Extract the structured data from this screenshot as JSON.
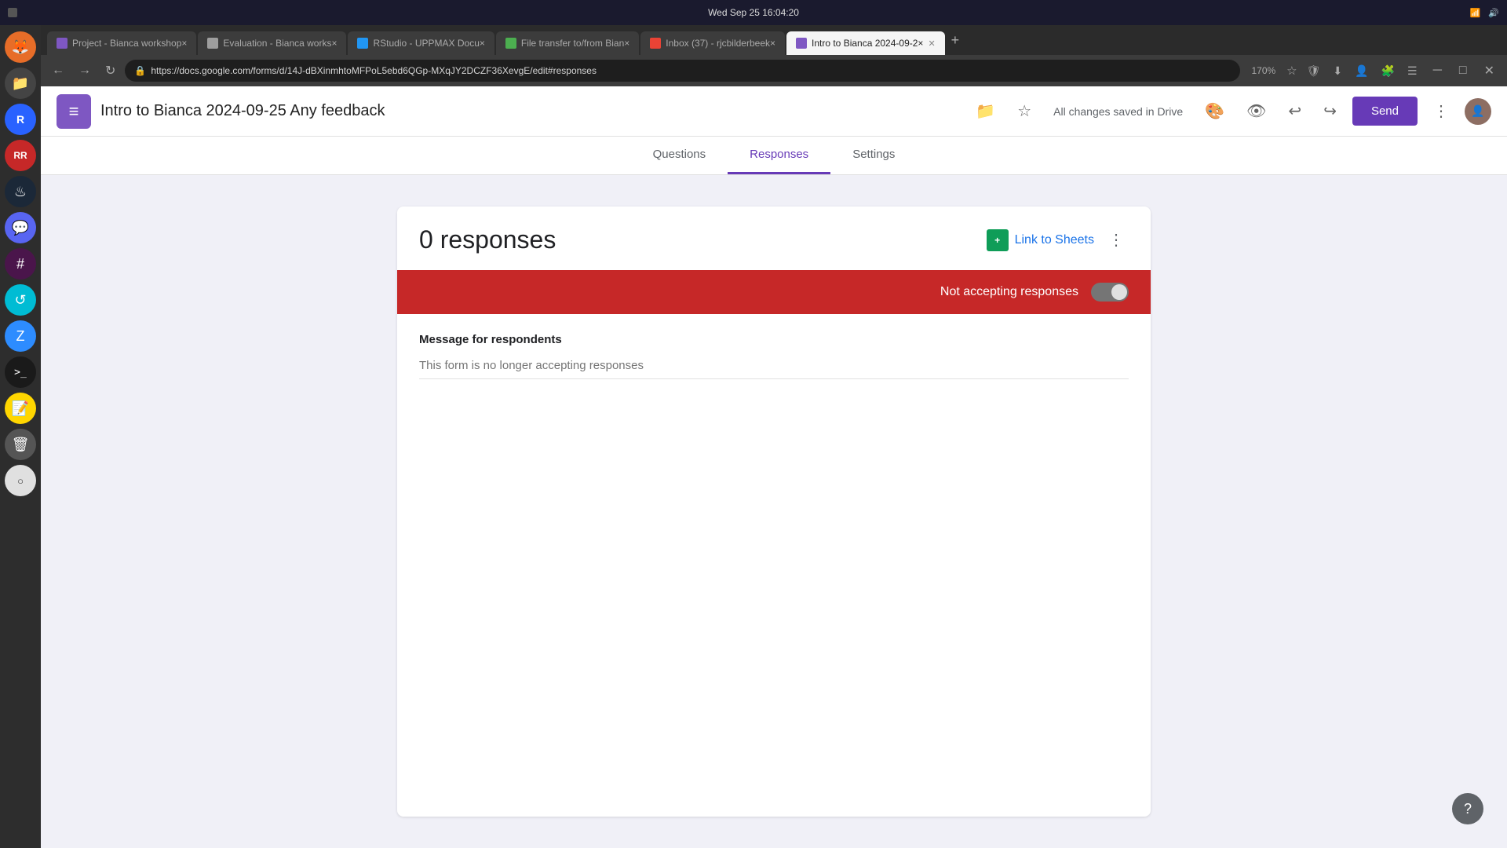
{
  "taskbar": {
    "datetime": "Wed Sep 25  16:04:20",
    "start_label": "⊞"
  },
  "browser": {
    "tabs": [
      {
        "id": "tab-project",
        "favicon_class": "purple",
        "label": "Project - Bianca workshop×",
        "active": false
      },
      {
        "id": "tab-evaluation",
        "favicon_class": "eval",
        "label": "Evaluation - Bianca works×",
        "active": false
      },
      {
        "id": "tab-rstudio",
        "favicon_class": "rstudio",
        "label": "RStudio - UPPMAX Docu×",
        "active": false
      },
      {
        "id": "tab-file-transfer",
        "favicon_class": "file-transfer",
        "label": "File transfer to/from Bian×",
        "active": false
      },
      {
        "id": "tab-gmail",
        "favicon_class": "gmail",
        "label": "Inbox (37) - rjcbilderbeek×",
        "active": false
      },
      {
        "id": "tab-forms",
        "favicon_class": "forms",
        "label": "Intro to Bianca 2024-09-2×",
        "active": true
      }
    ],
    "url": "https://docs.google.com/forms/d/14J-dBXinmhtoMFPoL5ebd6QGp-MXqJY2DCZF36XevgE/edit#responses",
    "zoom": "170%"
  },
  "app": {
    "icon": "≡",
    "title": "Intro to Bianca 2024-09-25 Any feedback",
    "save_status": "All changes saved in Drive",
    "send_label": "Send"
  },
  "tabs_nav": {
    "items": [
      {
        "id": "questions",
        "label": "Questions",
        "active": false
      },
      {
        "id": "responses",
        "label": "Responses",
        "active": true
      },
      {
        "id": "settings",
        "label": "Settings",
        "active": false
      }
    ]
  },
  "responses": {
    "count_label": "0 responses",
    "link_to_sheets_label": "Link to Sheets",
    "not_accepting_label": "Not accepting responses",
    "message_section_label": "Message for respondents",
    "message_placeholder": "This form is no longer accepting responses"
  },
  "help": {
    "label": "?"
  },
  "sidebar": {
    "icons": [
      {
        "id": "firefox",
        "class": "firefox",
        "symbol": "🦊"
      },
      {
        "id": "files",
        "class": "files",
        "symbol": "📁"
      },
      {
        "id": "r-blue",
        "class": "r-blue",
        "symbol": "R"
      },
      {
        "id": "rr",
        "class": "rr",
        "symbol": "RR"
      },
      {
        "id": "steam",
        "class": "steam",
        "symbol": "♨"
      },
      {
        "id": "discord",
        "class": "discord",
        "symbol": "💬"
      },
      {
        "id": "slack",
        "class": "slack",
        "symbol": "#"
      },
      {
        "id": "recyclarr",
        "class": "recyclarr",
        "symbol": "↺"
      },
      {
        "id": "zoom",
        "class": "zoom",
        "symbol": "Z"
      },
      {
        "id": "terminal",
        "class": "terminal",
        "symbol": ">_"
      },
      {
        "id": "notes",
        "class": "notes",
        "symbol": "📝"
      },
      {
        "id": "trash",
        "class": "trash",
        "symbol": "🗑"
      },
      {
        "id": "circle",
        "class": "circle",
        "symbol": "○"
      }
    ]
  }
}
